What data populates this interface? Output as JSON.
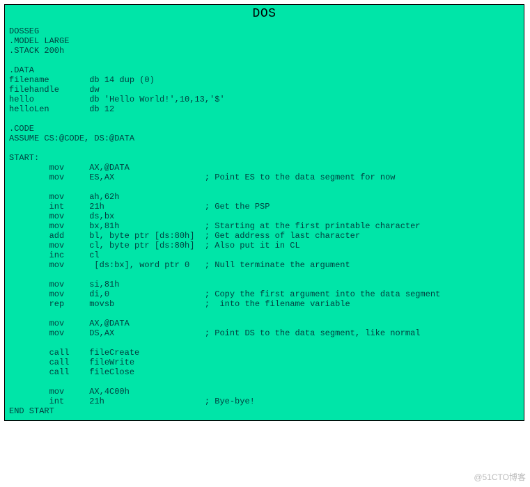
{
  "title": "DOS",
  "code_lines": [
    "DOSSEG",
    ".MODEL LARGE",
    ".STACK 200h",
    "",
    ".DATA",
    "filename        db 14 dup (0)",
    "filehandle      dw",
    "hello           db 'Hello World!',10,13,'$'",
    "helloLen        db 12",
    "",
    ".CODE",
    "ASSUME CS:@CODE, DS:@DATA",
    "",
    "START:",
    "        mov     AX,@DATA",
    "        mov     ES,AX                  ; Point ES to the data segment for now",
    "",
    "        mov     ah,62h",
    "        int     21h                    ; Get the PSP",
    "        mov     ds,bx",
    "        mov     bx,81h                 ; Starting at the first printable character",
    "        add     bl, byte ptr [ds:80h]  ; Get address of last character",
    "        mov     cl, byte ptr [ds:80h]  ; Also put it in CL",
    "        inc     cl",
    "        mov      [ds:bx], word ptr 0   ; Null terminate the argument",
    "",
    "        mov     si,81h",
    "        mov     di,0                   ; Copy the first argument into the data segment",
    "        rep     movsb                  ;  into the filename variable",
    "",
    "        mov     AX,@DATA",
    "        mov     DS,AX                  ; Point DS to the data segment, like normal",
    "",
    "        call    fileCreate",
    "        call    fileWrite",
    "        call    fileClose",
    "",
    "        mov     AX,4C00h",
    "        int     21h                    ; Bye-bye!",
    "END START"
  ],
  "watermark": "@51CTO博客"
}
